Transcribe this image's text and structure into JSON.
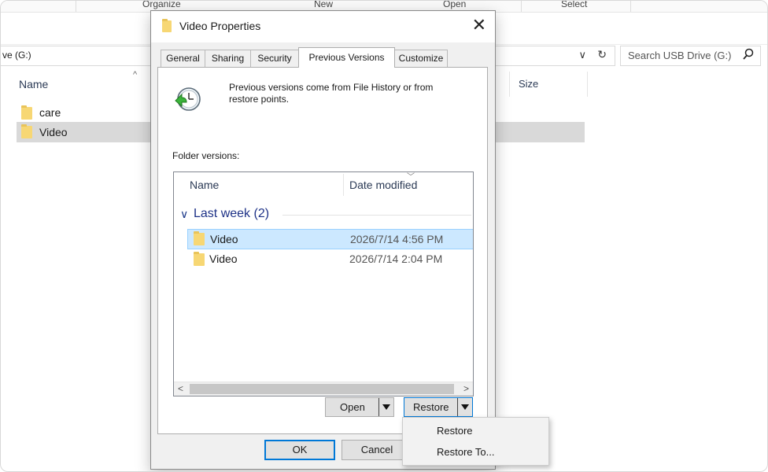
{
  "ribbon": {
    "organize": "Organize",
    "new": "New",
    "open": "Open",
    "select": "Select"
  },
  "address": {
    "path": "ve (G:)",
    "chevron": "∨",
    "refresh": "↻"
  },
  "search": {
    "placeholder": "Search USB Drive (G:)"
  },
  "explorer": {
    "columns": {
      "name": "Name",
      "size": "Size"
    },
    "items": [
      {
        "name": "care"
      },
      {
        "name": "Video"
      }
    ]
  },
  "dialog": {
    "title": "Video Properties",
    "close": "✕",
    "tabs": [
      "General",
      "Sharing",
      "Security",
      "Previous Versions",
      "Customize"
    ],
    "info": "Previous versions come from File History or from restore points.",
    "folder_versions_label": "Folder versions:",
    "list": {
      "columns": {
        "name": "Name",
        "date": "Date modified"
      },
      "group": "Last week (2)",
      "rows": [
        {
          "name": "Video",
          "date": "2026/7/14  4:56 PM"
        },
        {
          "name": "Video",
          "date": "2026/7/14  2:04 PM"
        }
      ]
    },
    "buttons": {
      "open": "Open",
      "restore": "Restore",
      "ok": "OK",
      "cancel": "Cancel"
    }
  },
  "restore_menu": {
    "items": [
      "Restore",
      "Restore To..."
    ]
  },
  "colors": {
    "accent": "#0078d7",
    "selection": "#cce8ff",
    "group_text": "#1e3287"
  }
}
